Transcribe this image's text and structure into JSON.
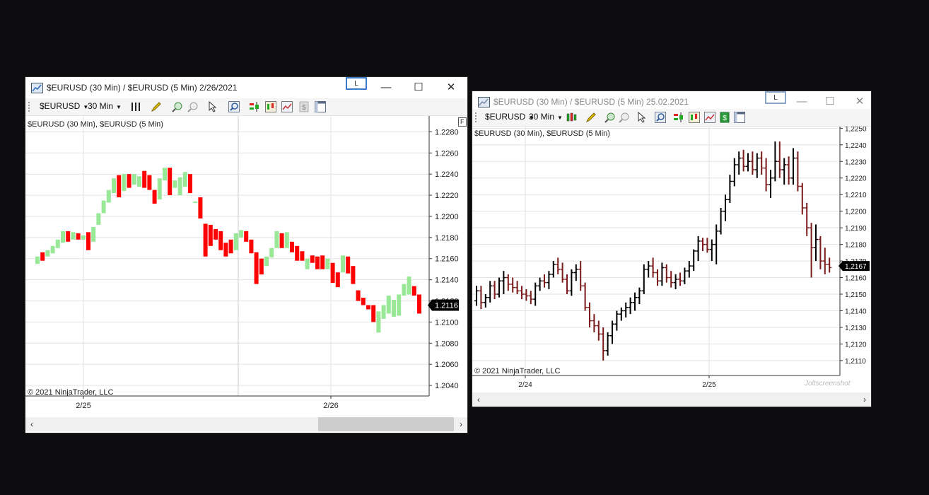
{
  "window1": {
    "title": "$EURUSD (30 Min) / $EURUSD (5 Min)  2/26/2021",
    "l_button": "L",
    "minimize": "—",
    "maximize": "☐",
    "close": "✕",
    "toolbar": {
      "instrument": "$EURUSD",
      "interval": "30 Min"
    },
    "chart_label": "$EURUSD (30 Min), $EURUSD (5 Min)",
    "f_button": "F",
    "copyright": "© 2021 NinjaTrader, LLC",
    "price_marker": "1.2116",
    "scroll_left": "‹",
    "scroll_right": "›"
  },
  "window2": {
    "title": "$EURUSD (30 Min) / $EURUSD (5 Min)  25.02.2021",
    "l_button": "L",
    "minimize": "—",
    "maximize": "☐",
    "close": "✕",
    "toolbar": {
      "instrument": "$EURUSD",
      "interval": "30 Min"
    },
    "chart_label": "$EURUSD (30 Min), $EURUSD (5 Min)",
    "copyright": "© 2021 NinjaTrader, LLC",
    "price_marker": "1,2167",
    "watermark": "Joltscreenshot",
    "scroll_left": "‹",
    "scroll_right": "›"
  },
  "colors": {
    "up": "#98e898",
    "down": "#ff0000",
    "bar": "#000000",
    "bar_down": "#7a1a1a",
    "grid": "#e2e2e2"
  },
  "chart_data": [
    {
      "type": "bar",
      "style": "open-close blocks",
      "x_ticks": [
        "2/25",
        "2/26"
      ],
      "y_ticks": [
        "1.2040",
        "1.2060",
        "1.2080",
        "1.2100",
        "1.2120",
        "1.2140",
        "1.2160",
        "1.2180",
        "1.2200",
        "1.2220",
        "1.2240",
        "1.2260",
        "1.2280"
      ],
      "ylim": [
        1.203,
        1.2295
      ],
      "last_price": 1.2116,
      "grid": true,
      "bars": [
        [
          1.2155,
          1.2162
        ],
        [
          1.2166,
          1.2158
        ],
        [
          1.2162,
          1.2168
        ],
        [
          1.2165,
          1.2172
        ],
        [
          1.217,
          1.2178
        ],
        [
          1.2175,
          1.2186
        ],
        [
          1.2186,
          1.2176
        ],
        [
          1.2178,
          1.2185
        ],
        [
          1.2184,
          1.2178
        ],
        [
          1.2178,
          1.2182
        ],
        [
          1.2185,
          1.2168
        ],
        [
          1.2176,
          1.219
        ],
        [
          1.2192,
          1.2203
        ],
        [
          1.2203,
          1.2215
        ],
        [
          1.2213,
          1.2225
        ],
        [
          1.2222,
          1.2236
        ],
        [
          1.2239,
          1.2218
        ],
        [
          1.2224,
          1.224
        ],
        [
          1.224,
          1.2227
        ],
        [
          1.223,
          1.224
        ],
        [
          1.2228,
          1.2238
        ],
        [
          1.2243,
          1.2227
        ],
        [
          1.2239,
          1.2225
        ],
        [
          1.2225,
          1.2212
        ],
        [
          1.2216,
          1.2236
        ],
        [
          1.2234,
          1.2246
        ],
        [
          1.2246,
          1.222
        ],
        [
          1.2227,
          1.2234
        ],
        [
          1.222,
          1.2237
        ],
        [
          1.2228,
          1.2242
        ],
        [
          1.224,
          1.2222
        ],
        [
          1.2214,
          1.2214
        ],
        [
          1.2218,
          1.2198
        ],
        [
          1.2193,
          1.2162
        ],
        [
          1.2192,
          1.2172
        ],
        [
          1.2188,
          1.2178
        ],
        [
          1.2186,
          1.2168
        ],
        [
          1.2175,
          1.2162
        ],
        [
          1.2178,
          1.2165
        ],
        [
          1.2168,
          1.2184
        ],
        [
          1.218,
          1.2187
        ],
        [
          1.2186,
          1.2176
        ],
        [
          1.2178,
          1.2165
        ],
        [
          1.2166,
          1.2136
        ],
        [
          1.216,
          1.2145
        ],
        [
          1.2153,
          1.2162
        ],
        [
          1.2161,
          1.217
        ],
        [
          1.217,
          1.2186
        ],
        [
          1.2184,
          1.217
        ],
        [
          1.217,
          1.2185
        ],
        [
          1.2176,
          1.2166
        ],
        [
          1.2172,
          1.2158
        ],
        [
          1.2167,
          1.2158
        ],
        [
          1.215,
          1.216
        ],
        [
          1.2163,
          1.2156
        ],
        [
          1.2162,
          1.215
        ],
        [
          1.2163,
          1.215
        ],
        [
          1.215,
          1.216
        ],
        [
          1.2156,
          1.2137
        ],
        [
          1.2147,
          1.2133
        ],
        [
          1.2147,
          1.2163
        ],
        [
          1.2162,
          1.2146
        ],
        [
          1.2153,
          1.2136
        ],
        [
          1.213,
          1.212
        ],
        [
          1.2123,
          1.2116
        ],
        [
          1.2116,
          1.2112
        ],
        [
          1.2116,
          1.21
        ],
        [
          1.209,
          1.211
        ],
        [
          1.2103,
          1.2116
        ],
        [
          1.2108,
          1.2125
        ],
        [
          1.2105,
          1.2121
        ],
        [
          1.2106,
          1.2126
        ],
        [
          1.2125,
          1.2136
        ],
        [
          1.2126,
          1.2143
        ],
        [
          1.2134,
          1.2125
        ],
        [
          1.2126,
          1.2108
        ]
      ]
    },
    {
      "type": "bar",
      "style": "ohlc",
      "x_ticks": [
        "2/24",
        "2/25"
      ],
      "y_ticks": [
        "1,2110",
        "1,2120",
        "1,2130",
        "1,2140",
        "1,2150",
        "1,2160",
        "1,2170",
        "1,2180",
        "1,2190",
        "1,2200",
        "1,2210",
        "1,2220",
        "1,2230",
        "1,2240",
        "1,2250"
      ],
      "ylim": [
        1.2101,
        1.2251
      ],
      "last_price": 1.2167,
      "grid": true,
      "bars": [
        [
          1.2146,
          1.2155,
          1.2143,
          1.2152
        ],
        [
          1.2152,
          1.2155,
          1.2141,
          1.2145
        ],
        [
          1.2145,
          1.215,
          1.2142,
          1.2148
        ],
        [
          1.2148,
          1.2158,
          1.2145,
          1.2155
        ],
        [
          1.2155,
          1.2158,
          1.2147,
          1.215
        ],
        [
          1.215,
          1.216,
          1.2148,
          1.2158
        ],
        [
          1.2158,
          1.2164,
          1.215,
          1.216
        ],
        [
          1.216,
          1.2162,
          1.2152,
          1.2156
        ],
        [
          1.2156,
          1.216,
          1.2151,
          1.2154
        ],
        [
          1.2154,
          1.2158,
          1.215,
          1.2152
        ],
        [
          1.2152,
          1.2155,
          1.2147,
          1.215
        ],
        [
          1.215,
          1.2153,
          1.2146,
          1.2149
        ],
        [
          1.2149,
          1.2152,
          1.2144,
          1.2147
        ],
        [
          1.2147,
          1.2157,
          1.2143,
          1.2155
        ],
        [
          1.2155,
          1.216,
          1.2152,
          1.2158
        ],
        [
          1.2158,
          1.2162,
          1.2154,
          1.2157
        ],
        [
          1.2157,
          1.2164,
          1.2153,
          1.2162
        ],
        [
          1.2162,
          1.217,
          1.216,
          1.2168
        ],
        [
          1.2168,
          1.2172,
          1.2162,
          1.2165
        ],
        [
          1.2165,
          1.2169,
          1.2157,
          1.2159
        ],
        [
          1.2159,
          1.2162,
          1.215,
          1.2152
        ],
        [
          1.2152,
          1.2165,
          1.2149,
          1.2163
        ],
        [
          1.2163,
          1.2168,
          1.2158,
          1.2165
        ],
        [
          1.2165,
          1.217,
          1.2152,
          1.2155
        ],
        [
          1.2155,
          1.2157,
          1.214,
          1.2142
        ],
        [
          1.2142,
          1.2145,
          1.213,
          1.2134
        ],
        [
          1.2134,
          1.2138,
          1.2127,
          1.2131
        ],
        [
          1.2131,
          1.2134,
          1.2122,
          1.2126
        ],
        [
          1.2126,
          1.213,
          1.211,
          1.2116
        ],
        [
          1.2116,
          1.2127,
          1.2113,
          1.2125
        ],
        [
          1.2125,
          1.2134,
          1.212,
          1.2132
        ],
        [
          1.2132,
          1.214,
          1.2128,
          1.2138
        ],
        [
          1.2138,
          1.2142,
          1.2134,
          1.214
        ],
        [
          1.214,
          1.2145,
          1.2136,
          1.2142
        ],
        [
          1.2142,
          1.2148,
          1.2138,
          1.2145
        ],
        [
          1.2145,
          1.2151,
          1.214,
          1.2148
        ],
        [
          1.2148,
          1.2154,
          1.2144,
          1.2152
        ],
        [
          1.2152,
          1.2168,
          1.215,
          1.2165
        ],
        [
          1.2165,
          1.217,
          1.216,
          1.2167
        ],
        [
          1.2167,
          1.2172,
          1.216,
          1.2163
        ],
        [
          1.2163,
          1.2165,
          1.2155,
          1.2158
        ],
        [
          1.2158,
          1.2169,
          1.2155,
          1.2166
        ],
        [
          1.2166,
          1.2168,
          1.2157,
          1.216
        ],
        [
          1.216,
          1.2164,
          1.2154,
          1.2157
        ],
        [
          1.2157,
          1.2162,
          1.2153,
          1.2159
        ],
        [
          1.2159,
          1.2163,
          1.2155,
          1.2158
        ],
        [
          1.2158,
          1.2166,
          1.2156,
          1.2164
        ],
        [
          1.2164,
          1.217,
          1.216,
          1.2167
        ],
        [
          1.2167,
          1.2177,
          1.2164,
          1.2176
        ],
        [
          1.2176,
          1.2185,
          1.217,
          1.2182
        ],
        [
          1.2182,
          1.2184,
          1.2176,
          1.218
        ],
        [
          1.218,
          1.2184,
          1.2175,
          1.2177
        ],
        [
          1.2177,
          1.2183,
          1.217,
          1.218
        ],
        [
          1.218,
          1.2192,
          1.2168,
          1.2188
        ],
        [
          1.2188,
          1.2202,
          1.2186,
          1.22
        ],
        [
          1.22,
          1.221,
          1.2194,
          1.2207
        ],
        [
          1.2207,
          1.2222,
          1.2205,
          1.2218
        ],
        [
          1.2218,
          1.2232,
          1.2215,
          1.2228
        ],
        [
          1.2228,
          1.2236,
          1.2222,
          1.2232
        ],
        [
          1.2232,
          1.2237,
          1.2224,
          1.2227
        ],
        [
          1.2227,
          1.2235,
          1.2224,
          1.223
        ],
        [
          1.223,
          1.2236,
          1.2222,
          1.2225
        ],
        [
          1.2225,
          1.2235,
          1.222,
          1.2232
        ],
        [
          1.2232,
          1.2236,
          1.2222,
          1.2226
        ],
        [
          1.2226,
          1.2232,
          1.2212,
          1.2216
        ],
        [
          1.2216,
          1.2225,
          1.2208,
          1.222
        ],
        [
          1.222,
          1.2242,
          1.2218,
          1.223
        ],
        [
          1.223,
          1.2242,
          1.222,
          1.2225
        ],
        [
          1.2225,
          1.2232,
          1.2216,
          1.2228
        ],
        [
          1.2228,
          1.2233,
          1.2216,
          1.222
        ],
        [
          1.222,
          1.2238,
          1.2216,
          1.2232
        ],
        [
          1.2232,
          1.2236,
          1.2212,
          1.2215
        ],
        [
          1.2215,
          1.2217,
          1.2198,
          1.2202
        ],
        [
          1.2202,
          1.2205,
          1.2185,
          1.219
        ],
        [
          1.219,
          1.2193,
          1.216,
          1.2178
        ],
        [
          1.2178,
          1.2192,
          1.217,
          1.2183
        ],
        [
          1.2183,
          1.2185,
          1.2165,
          1.217
        ],
        [
          1.217,
          1.2178,
          1.2162,
          1.2168
        ],
        [
          1.2168,
          1.2172,
          1.2163,
          1.2166
        ]
      ]
    }
  ]
}
